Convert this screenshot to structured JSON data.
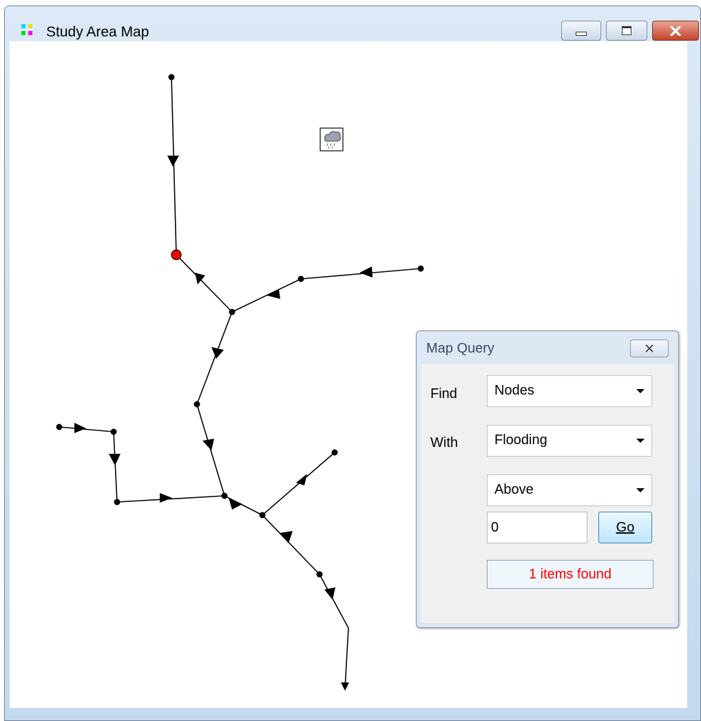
{
  "window": {
    "title": "Study Area Map",
    "app_icon": "map-app-icon",
    "controls": [
      "minimize-icon",
      "maximize-icon",
      "close-icon"
    ]
  },
  "map": {
    "selected_node_color": "#ff0000",
    "link_color": "#000000",
    "raingage_icon": "rain-cloud-icon"
  },
  "query_dialog": {
    "title": "Map Query",
    "find_label": "Find",
    "find_value": "Nodes",
    "with_label": "With",
    "with_value": "Flooding",
    "condition_value": "Above",
    "value_input": "0",
    "go_button_label": "Go",
    "status_text": "1 items found"
  }
}
